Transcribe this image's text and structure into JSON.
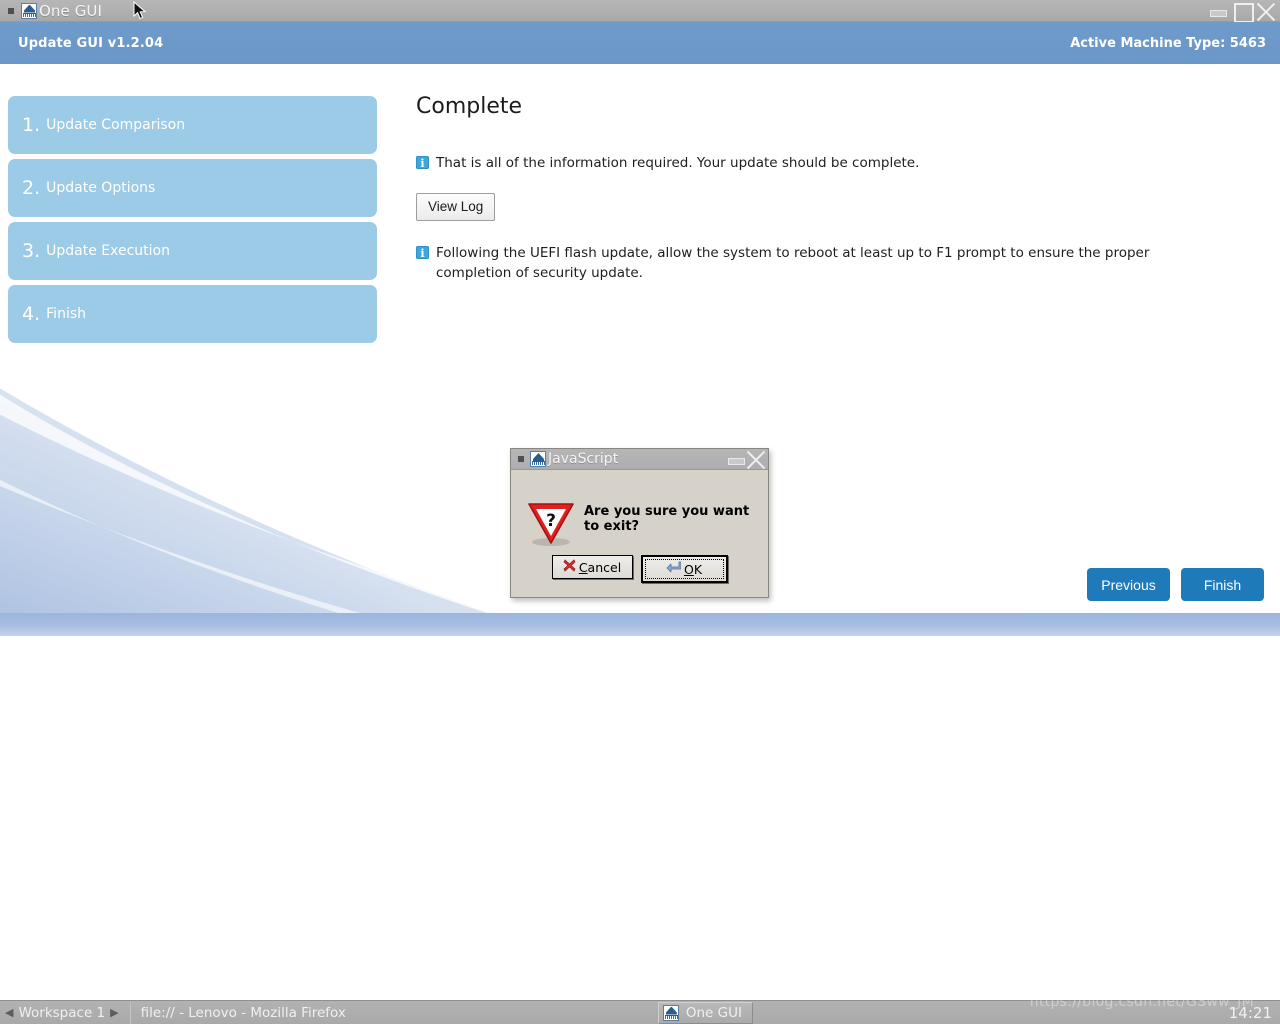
{
  "window": {
    "title": "One GUI",
    "icon": "java-app-icon",
    "controls": [
      {
        "name": "minimize",
        "glyph": "minimize-icon"
      },
      {
        "name": "maximize",
        "glyph": "maximize-icon"
      },
      {
        "name": "close",
        "glyph": "close-icon"
      }
    ]
  },
  "app": {
    "header": {
      "title": "Update GUI v1.2.04",
      "machine_type": "Active Machine Type: 5463"
    },
    "sidebar": {
      "items": [
        {
          "num": "1.",
          "label": "Update Comparison"
        },
        {
          "num": "2.",
          "label": "Update Options"
        },
        {
          "num": "3.",
          "label": "Update Execution"
        },
        {
          "num": "4.",
          "label": "Finish"
        }
      ]
    },
    "main": {
      "page_title": "Complete",
      "info_1": "That is all of the information required. Your update should be complete.",
      "view_log_label": "View Log",
      "info_2": "Following the UEFI flash update, allow the system to reboot at least up to F1 prompt to ensure the proper completion of security update."
    },
    "nav": {
      "previous_label": "Previous",
      "finish_label": "Finish"
    },
    "colors": {
      "header_blue": "#6b97c8",
      "step_blue": "#9ccbe7",
      "button_blue": "#1e7ab8",
      "footer_blue": "#a8bee2",
      "info_icon_blue": "#3ba8dd"
    }
  },
  "dialog": {
    "title": "JavaScript",
    "icon": "java-app-icon",
    "message": "Are you sure you want to exit?",
    "warning_icon": "warning-question-triangle-icon",
    "buttons": [
      {
        "name": "cancel",
        "label": "Cancel",
        "mnemonic": "C",
        "icon": "red-x-icon",
        "focused": false
      },
      {
        "name": "ok",
        "label": "OK",
        "mnemonic": "O",
        "icon": "enter-arrow-icon",
        "focused": true
      }
    ],
    "controls": [
      {
        "name": "minimize",
        "glyph": "minimize-icon"
      },
      {
        "name": "close",
        "glyph": "close-icon"
      }
    ]
  },
  "taskbar": {
    "workspace_prev": "◀",
    "workspace_label": "Workspace 1",
    "workspace_next": "▶",
    "tasks": [
      {
        "label": "file:// - Lenovo - Mozilla Firefox",
        "active": false
      },
      {
        "label": "One GUI",
        "active": true
      }
    ],
    "clock": "14:21"
  },
  "watermark": "https://blog.csdn.net/GSww_JM"
}
